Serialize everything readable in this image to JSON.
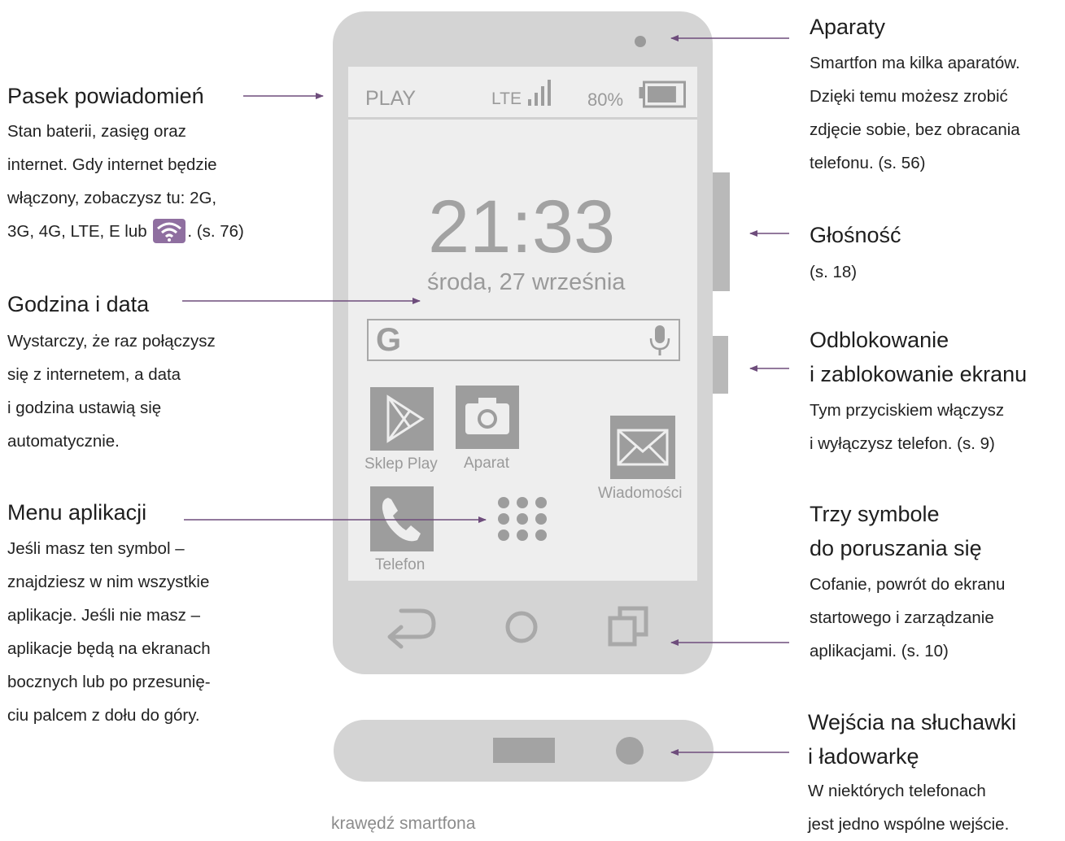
{
  "phone": {
    "status_bar": {
      "carrier": "PLAY",
      "network": "LTE",
      "battery_percent": "80%",
      "battery_level": 0.85
    },
    "clock": "21:33",
    "date": "środa, 27 września",
    "search_logo": "G",
    "search_icon": "microphone-icon",
    "apps": [
      {
        "label": "Sklep Play",
        "icon": "play-store-icon"
      },
      {
        "label": "Aparat",
        "icon": "camera-icon"
      },
      {
        "label": "Wiadomości",
        "icon": "envelope-icon"
      },
      {
        "label": "Telefon",
        "icon": "phone-handset-icon"
      }
    ],
    "app_drawer_icon": "app-grid-icon",
    "nav_buttons": [
      "back-icon",
      "home-icon",
      "recent-apps-icon"
    ]
  },
  "edge_caption": "krawędź smartfona",
  "left_annotations": {
    "notifications": {
      "title": "Pasek powiadomień",
      "lines": [
        "Stan baterii, zasięg oraz",
        "internet. Gdy internet będzie",
        "włączony, zobaczysz tu: 2G,"
      ],
      "last_line_before": "3G, 4G, LTE, E lub",
      "last_line_after": ". (s. 76)"
    },
    "clock_date": {
      "title": "Godzina i data",
      "lines": [
        "Wystarczy, że raz połączysz",
        "się z internetem, a data",
        "i godzina ustawią się",
        "automatycznie."
      ]
    },
    "app_menu": {
      "title": "Menu aplikacji",
      "lines": [
        "Jeśli masz ten symbol –",
        "znajdziesz w nim wszystkie",
        "aplikacje. Jeśli nie masz –",
        "aplikacje będą na ekranach",
        "bocznych lub po przesunię-",
        "ciu palcem z dołu do góry."
      ]
    }
  },
  "right_annotations": {
    "cameras": {
      "title": "Aparaty",
      "lines": [
        "Smartfon ma kilka aparatów.",
        "Dzięki temu możesz zrobić",
        "zdjęcie sobie, bez obracania",
        "telefonu. (s. 56)"
      ]
    },
    "volume": {
      "title": "Głośność",
      "lines": [
        "(s. 18)"
      ]
    },
    "lock": {
      "title_lines": [
        "Odblokowanie",
        "i zablokowanie ekranu"
      ],
      "lines": [
        "Tym przyciskiem włączysz",
        "i wyłączysz telefon. (s. 9)"
      ]
    },
    "navigation": {
      "title_lines": [
        "Trzy symbole",
        "do poruszania się"
      ],
      "lines": [
        "Cofanie, powrót do ekranu",
        "startowego i zarządzanie",
        "aplikacjami. (s. 10)"
      ]
    },
    "ports": {
      "title_lines": [
        "Wejścia na słuchawki",
        "i ładowarkę"
      ],
      "lines": [
        "W niektórych telefonach",
        "jest jedno wspólne wejście."
      ]
    }
  },
  "colors": {
    "arrow": "#6e4d7c",
    "phone_body": "#d4d4d4",
    "screen": "#eeeeee",
    "icon_gray": "#9d9d9d",
    "wifi_badge": "#8f6fa0"
  }
}
